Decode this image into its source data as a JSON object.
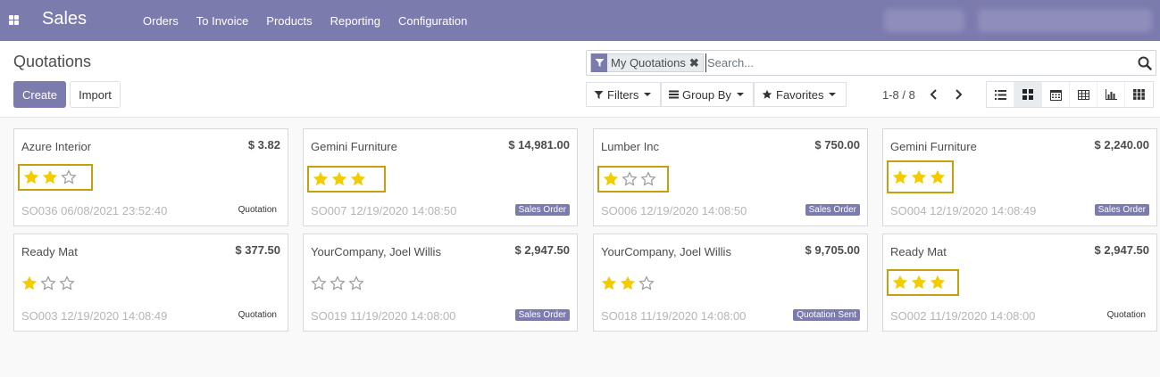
{
  "app": {
    "title": "Sales",
    "menu": [
      "Orders",
      "To Invoice",
      "Products",
      "Reporting",
      "Configuration"
    ]
  },
  "control": {
    "breadcrumb": "Quotations",
    "create_label": "Create",
    "import_label": "Import",
    "search": {
      "facet_label": "My Quotations",
      "facet_close": "✖",
      "placeholder": "Search..."
    },
    "filters_label": "Filters",
    "groupby_label": "Group By",
    "favorites_label": "Favorites",
    "pager": "1-8 / 8",
    "views": [
      "list-view-icon",
      "kanban-view-icon",
      "calendar-view-icon",
      "pivot-view-icon",
      "graph-view-icon",
      "activity-view-icon"
    ],
    "active_view": "kanban-view-icon"
  },
  "colors": {
    "brand": "#7c7bad",
    "star_filled": "#f3cc00",
    "highlight_border": "#c59f0f"
  },
  "cards": [
    {
      "name": "Azure Interior",
      "amount": "$ 3.82",
      "stars": 2,
      "ref": "SO036 06/08/2021 23:52:40",
      "state": "Quotation",
      "badge": false,
      "highlighted": true
    },
    {
      "name": "Gemini Furniture",
      "amount": "$ 14,981.00",
      "stars": 3,
      "ref": "SO007 12/19/2020 14:08:50",
      "state": "Sales Order",
      "badge": true,
      "highlighted": true
    },
    {
      "name": "Lumber Inc",
      "amount": "$ 750.00",
      "stars": 1,
      "ref": "SO006 12/19/2020 14:08:50",
      "state": "Sales Order",
      "badge": true,
      "highlighted": true
    },
    {
      "name": "Gemini Furniture",
      "amount": "$ 2,240.00",
      "stars": 3,
      "ref": "SO004 12/19/2020 14:08:49",
      "state": "Sales Order",
      "badge": true,
      "highlighted": true
    },
    {
      "name": "Ready Mat",
      "amount": "$ 377.50",
      "stars": 1,
      "ref": "SO003 12/19/2020 14:08:49",
      "state": "Quotation",
      "badge": false,
      "highlighted": false
    },
    {
      "name": "YourCompany, Joel Willis",
      "amount": "$ 2,947.50",
      "stars": 0,
      "ref": "SO019 11/19/2020 14:08:00",
      "state": "Sales Order",
      "badge": true,
      "highlighted": false
    },
    {
      "name": "YourCompany, Joel Willis",
      "amount": "$ 9,705.00",
      "stars": 2,
      "ref": "SO018 11/19/2020 14:08:00",
      "state": "Quotation Sent",
      "badge": true,
      "highlighted": false
    },
    {
      "name": "Ready Mat",
      "amount": "$ 2,947.50",
      "stars": 3,
      "ref": "SO002 11/19/2020 14:08:00",
      "state": "Quotation",
      "badge": false,
      "highlighted": true
    }
  ]
}
